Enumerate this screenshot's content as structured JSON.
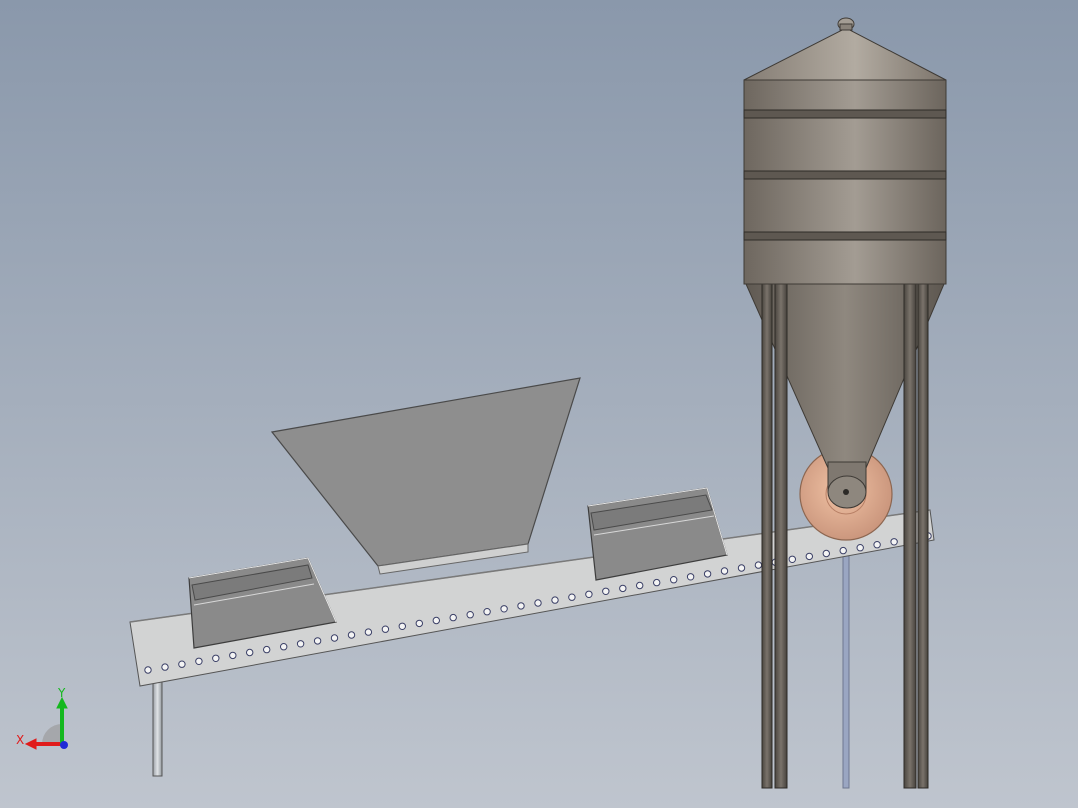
{
  "viewport": {
    "background_top": "#8a98ab",
    "background_bottom": "#bfc5ce"
  },
  "model": {
    "silo_color": "#7f7870",
    "hopper_color": "#8e8e8e",
    "conveyor_color": "#cfd0d0",
    "wheel_color": "#d9a98a",
    "bin_color": "#8a8a8a"
  },
  "triad": {
    "x_label": "X",
    "y_label": "Y",
    "x_color": "#e01b1b",
    "y_color": "#14b81e",
    "z_color": "#1f2ad6"
  }
}
